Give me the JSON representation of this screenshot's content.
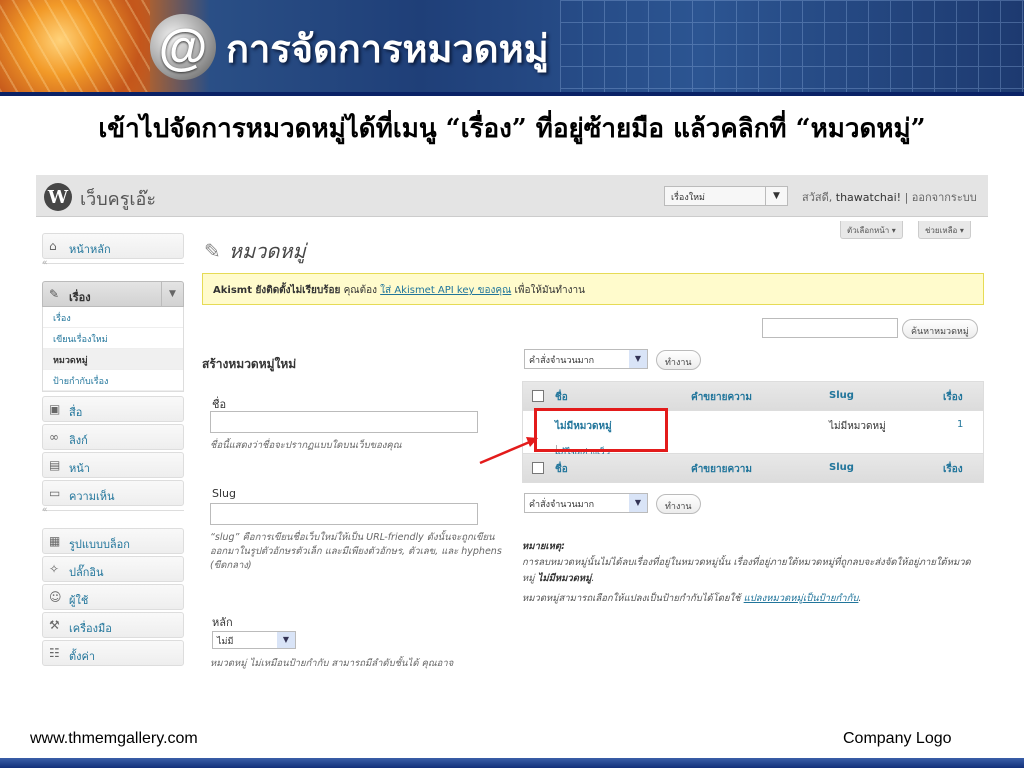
{
  "banner": {
    "icon_char": "@",
    "title": "การจัดการหมวดหมู่"
  },
  "subtitle": "เข้าไปจัดการหมวดหมู่ได้ที่เมนู “เรื่อง” ที่อยู่ซ้ายมือ  แล้วคลิกที่ “หมวดหมู่”",
  "wp": {
    "logo_char": "W",
    "site_name": "เว็บครูเอ๊ะ",
    "new_post_select": "เรื่องใหม่",
    "greeting_prefix": "สวัสดี,",
    "username": "thawatchai!",
    "logout_sep": "|",
    "logout": "ออกจากระบบ",
    "screen_options": "ตัวเลือกหน้า ▾",
    "help": "ช่วยเหลือ ▾",
    "page_title": "หมวดหมู่",
    "notice": {
      "strong": "Akismt ยังติดตั้งไม่เรียบร้อย",
      "text1": "คุณต้อง",
      "link": "ใส่ Akismet API key ของคุณ",
      "text2": "เพื่อให้มันทำงาน"
    },
    "search_button": "ค้นหาหมวดหมู่",
    "sidebar": {
      "dashboard": "หน้าหลัก",
      "posts": "เรื่อง",
      "posts_sub": [
        "เรื่อง",
        "เขียนเรื่องใหม่",
        "หมวดหมู่",
        "ป้ายกำกับเรื่อง"
      ],
      "media": "สื่อ",
      "links": "ลิงก์",
      "pages": "หน้า",
      "comments": "ความเห็น",
      "appearance": "รูปแบบบล็อก",
      "plugins": "ปลั๊กอิน",
      "users": "ผู้ใช้",
      "tools": "เครื่องมือ",
      "settings": "ตั้งค่า"
    },
    "form": {
      "title": "สร้างหมวดหมู่ใหม่",
      "name_label": "ชื่อ",
      "name_help": "ชื่อนี้แสดงว่าชื่อจะปรากฏแบบใดบนเว็บของคุณ",
      "slug_label": "Slug",
      "slug_help": "“slug” คือการเขียนชื่อเว็บใหม่ให้เป็น URL-friendly ดังนั้นจะถูกเขียนออกมาในรูปตัวอักษรตัวเล็ก และมีเพียงตัวอักษร, ตัวเลข, และ hyphens (ขีดกลาง)",
      "parent_label": "หลัก",
      "parent_value": "ไม่มี",
      "parent_help": "หมวดหมู่ ไม่เหมือนป้ายกำกับ สามารถมีลำดับชั้นได้ คุณอาจ"
    },
    "bulk_action": "คำสั่งจำนวนมาก",
    "apply_button": "ทำงาน",
    "table": {
      "col_name": "ชื่อ",
      "col_desc": "คำขยายความ",
      "col_slug": "Slug",
      "col_posts": "เรื่อง",
      "row": {
        "name": "ไม่มีหมวดหมู่",
        "slug": "ไม่มีหมวดหมู่",
        "count": "1",
        "edit": "แก้ไข",
        "sep": "|",
        "quick_edit": "แก้ไขอย่างเร็ว"
      }
    },
    "note": {
      "title": "หมายเหตุ:",
      "line1": "การลบหมวดหมู่นั้นไม่ได้ลบเรื่องที่อยู่ในหมวดหมู่นั้น เรื่องที่อยู่ภายใต้หมวดหมู่ที่ถูกลบจะส่งจัดให้อยู่ภายใต้หมวดหมู่",
      "line1_bold": "ไม่มีหมวดหมู่",
      "line1_end": ".",
      "line2": "หมวดหมู่สามารถเลือกให้แปลงเป็นป้ายกำกับได้โดยใช้",
      "line2_link": "แปลงหมวดหมู่เป็นป้ายกำกับ",
      "line2_end": "."
    }
  },
  "footer": {
    "left": "www.thmemgallery.com",
    "right": "Company Logo"
  }
}
